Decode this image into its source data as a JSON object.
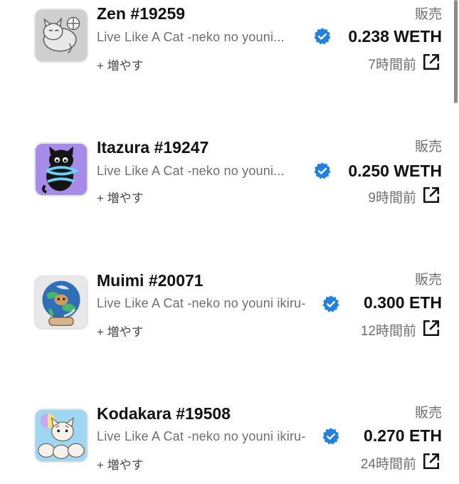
{
  "colors": {
    "verified_blue": "#2081e2",
    "text_primary": "#121212",
    "text_secondary": "#6f6f6f"
  },
  "items": [
    {
      "name": "Zen #19259",
      "collection": "Live Like A Cat -neko no youni...",
      "action": "+ 増やす",
      "event": "販売",
      "price": "0.238 WETH",
      "time": "7時間前",
      "thumb_bg": "#c9c9c9",
      "verified_icon": "verified-badge-icon",
      "external_icon": "external-link-icon"
    },
    {
      "name": "Itazura #19247",
      "collection": "Live Like A Cat -neko no youni...",
      "action": "+ 増やす",
      "event": "販売",
      "price": "0.250 WETH",
      "time": "9時間前",
      "thumb_bg": "#a78be8",
      "verified_icon": "verified-badge-icon",
      "external_icon": "external-link-icon"
    },
    {
      "name": "Muimi #20071",
      "collection": "Live Like A Cat -neko no youni ikiru-",
      "action": "+ 増やす",
      "event": "販売",
      "price": "0.300 ETH",
      "time": "12時間前",
      "thumb_bg": "#e8e8e8",
      "verified_icon": "verified-badge-icon",
      "external_icon": "external-link-icon"
    },
    {
      "name": "Kodakara #19508",
      "collection": "Live Like A Cat -neko no youni ikiru-",
      "action": "+ 増やす",
      "event": "販売",
      "price": "0.270 ETH",
      "time": "24時間前",
      "thumb_bg": "#9fd6f2",
      "verified_icon": "verified-badge-icon",
      "external_icon": "external-link-icon"
    }
  ]
}
